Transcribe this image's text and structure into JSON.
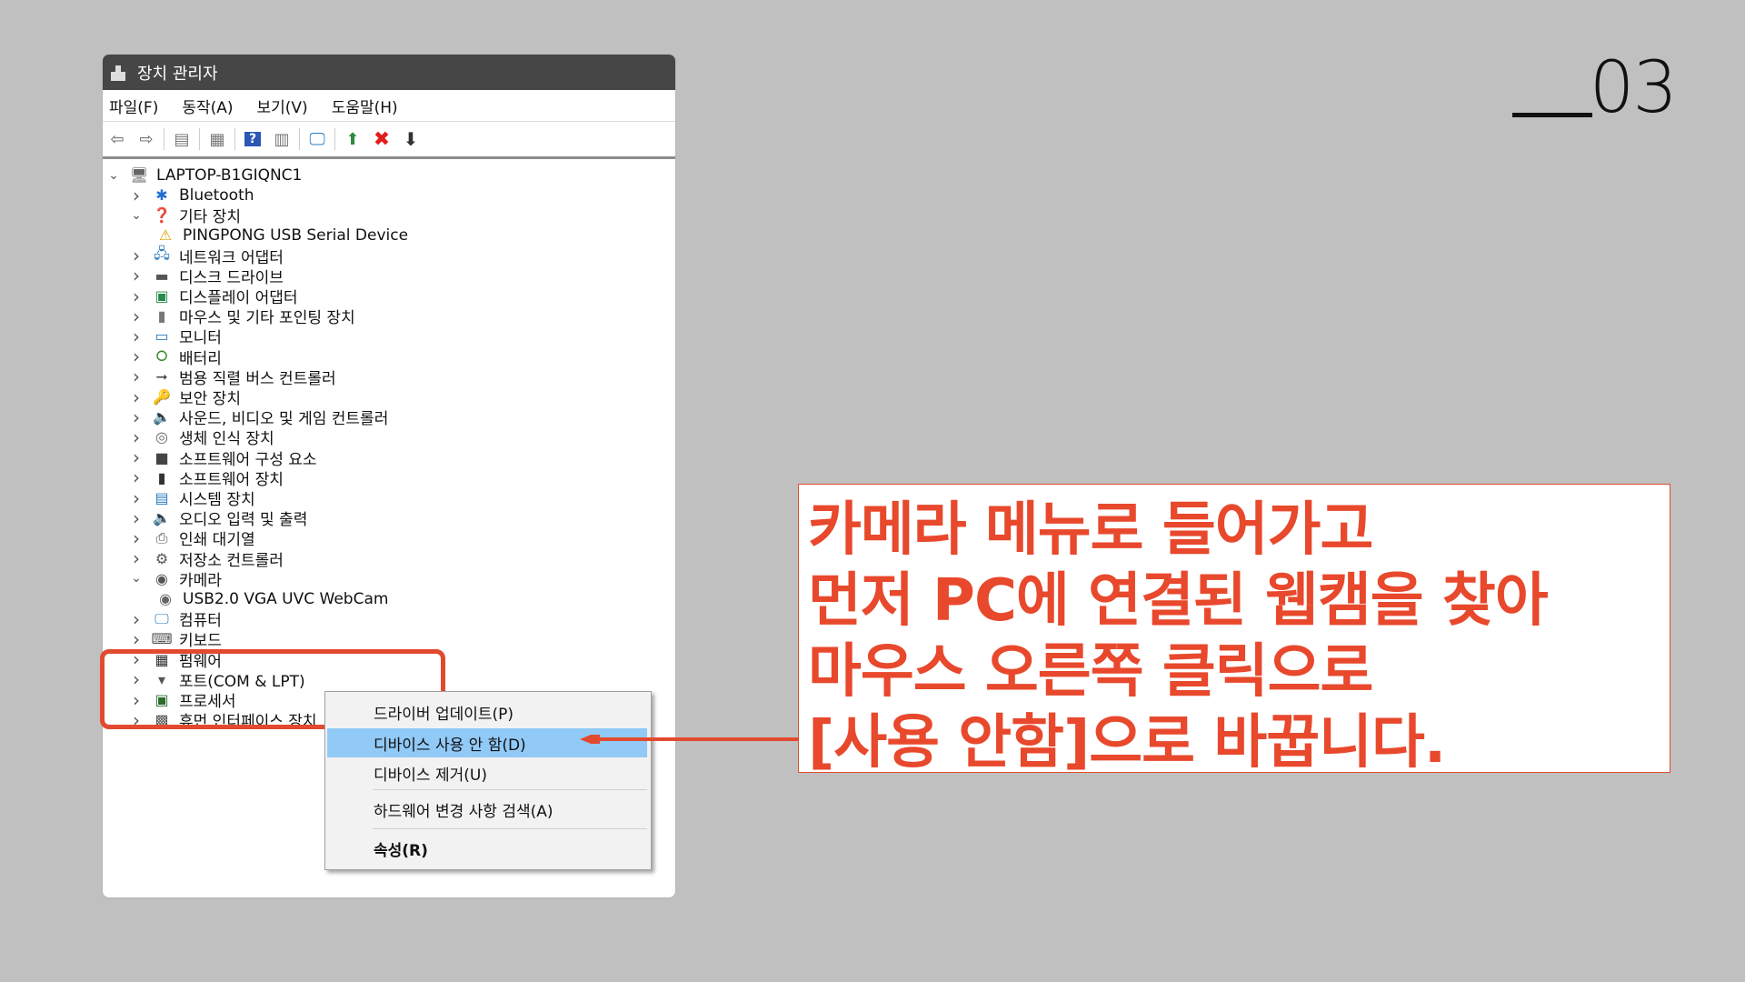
{
  "slide": {
    "number": "03"
  },
  "window": {
    "title": "장치 관리자",
    "menu": [
      "파일(F)",
      "동작(A)",
      "보기(V)",
      "도움말(H)"
    ]
  },
  "tree": {
    "root": "LAPTOP-B1GIQNC1",
    "items": [
      {
        "label": "Bluetooth",
        "icon": "bluetooth-icon",
        "expanded": false
      },
      {
        "label": "기타 장치",
        "icon": "other-devices-icon",
        "expanded": true
      },
      {
        "label": "PINGPONG USB Serial Device",
        "icon": "warning-device-icon",
        "child": true
      },
      {
        "label": "네트워크 어댑터",
        "icon": "network-adapter-icon",
        "expanded": false
      },
      {
        "label": "디스크 드라이브",
        "icon": "disk-drive-icon",
        "expanded": false
      },
      {
        "label": "디스플레이 어댑터",
        "icon": "display-adapter-icon",
        "expanded": false
      },
      {
        "label": "마우스 및 기타 포인팅 장치",
        "icon": "mouse-icon",
        "expanded": false
      },
      {
        "label": "모니터",
        "icon": "monitor-icon",
        "expanded": false
      },
      {
        "label": "배터리",
        "icon": "battery-icon",
        "expanded": false
      },
      {
        "label": "범용 직렬 버스 컨트롤러",
        "icon": "usb-controller-icon",
        "expanded": false
      },
      {
        "label": "보안 장치",
        "icon": "security-device-icon",
        "expanded": false
      },
      {
        "label": "사운드, 비디오 및 게임 컨트롤러",
        "icon": "sound-icon",
        "expanded": false
      },
      {
        "label": "생체 인식 장치",
        "icon": "biometric-icon",
        "expanded": false
      },
      {
        "label": "소프트웨어 구성 요소",
        "icon": "software-component-icon",
        "expanded": false
      },
      {
        "label": "소프트웨어 장치",
        "icon": "software-device-icon",
        "expanded": false
      },
      {
        "label": "시스템 장치",
        "icon": "system-device-icon",
        "expanded": false
      },
      {
        "label": "오디오 입력 및 출력",
        "icon": "audio-icon",
        "expanded": false
      },
      {
        "label": "인쇄 대기열",
        "icon": "printer-icon",
        "expanded": false
      },
      {
        "label": "저장소 컨트롤러",
        "icon": "storage-controller-icon",
        "expanded": false
      },
      {
        "label": "카메라",
        "icon": "camera-icon",
        "expanded": true
      },
      {
        "label": "USB2.0 VGA UVC WebCam",
        "icon": "webcam-icon",
        "child": true
      },
      {
        "label": "컴퓨터",
        "icon": "computer-icon",
        "expanded": false
      },
      {
        "label": "키보드",
        "icon": "keyboard-icon",
        "expanded": false
      },
      {
        "label": "펌웨어",
        "icon": "firmware-icon",
        "expanded": false
      },
      {
        "label": "포트(COM & LPT)",
        "icon": "port-icon",
        "expanded": false
      },
      {
        "label": "프로세서",
        "icon": "processor-icon",
        "expanded": false
      },
      {
        "label": "휴먼 인터페이스 장치",
        "icon": "hid-icon",
        "expanded": false
      }
    ]
  },
  "context_menu": {
    "update_driver": "드라이버 업데이트(P)",
    "disable_device": "디바이스 사용 안 함(D)",
    "uninstall_device": "디바이스 제거(U)",
    "scan_hardware": "하드웨어 변경 사항 검색(A)",
    "properties": "속성(R)"
  },
  "annotation": {
    "line1": "카메라 메뉴로 들어가고",
    "line2": "먼저 PC에 연결된 웹캠을 찾아",
    "line3": "마우스 오른쪽 클릭으로",
    "line4": "[사용 안함]으로 바꿉니다."
  },
  "colors": {
    "accent": "#e8482c",
    "selection": "#91c9f7",
    "titlebar": "#464646",
    "background": "#c0c0c0"
  }
}
